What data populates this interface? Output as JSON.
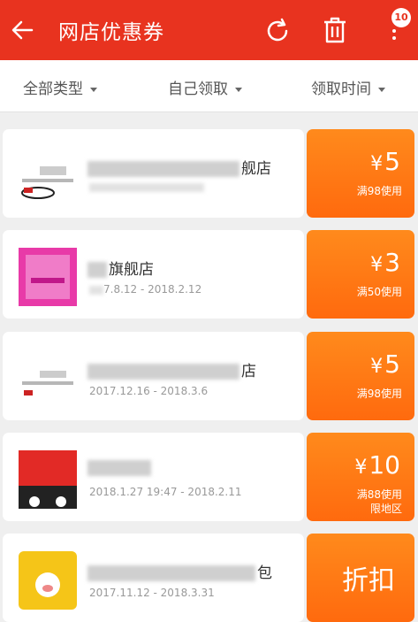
{
  "header": {
    "title": "网店优惠券",
    "badge_count": "10",
    "icons": [
      "back-arrow-icon",
      "refresh-icon",
      "trash-icon",
      "more-vertical-icon"
    ],
    "bg_color": "#e8331f"
  },
  "filters": [
    {
      "label": "全部类型"
    },
    {
      "label": "自己领取"
    },
    {
      "label": "领取时间"
    }
  ],
  "coupons": [
    {
      "store": "舰店",
      "dates": "",
      "amount": "5",
      "cond": "满98使用",
      "cond2": ""
    },
    {
      "store": "旗舰店",
      "dates": "7.8.12 - 2018.2.12",
      "amount": "3",
      "cond": "满50使用",
      "cond2": ""
    },
    {
      "store": "店",
      "dates": "2017.12.16 - 2018.3.6",
      "amount": "5",
      "cond": "满98使用",
      "cond2": ""
    },
    {
      "store": "",
      "dates": "2018.1.27 19:47 - 2018.2.11",
      "amount": "10",
      "cond": "满88使用",
      "cond2": "限地区"
    },
    {
      "store": "包",
      "dates": "2017.11.12 - 2018.3.31",
      "discount": "折扣"
    }
  ],
  "currency": "¥",
  "accent_color": "#ff7a16"
}
